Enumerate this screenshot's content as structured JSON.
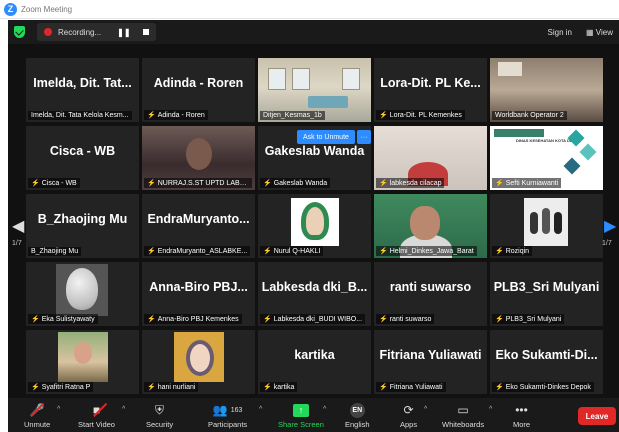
{
  "window": {
    "title": "Zoom Meeting",
    "logo_letter": "Z"
  },
  "topbar": {
    "recording": "Recording...",
    "pause": "❚❚",
    "sign_in": "Sign in",
    "view": "View"
  },
  "tiles": [
    {
      "big": "Imelda, Dit. Tat...",
      "name": "Imelda, Dit. Tata Kelola Kesm...",
      "muted": false
    },
    {
      "big": "Adinda - Roren",
      "name": "Adinda - Roren",
      "muted": true
    },
    {
      "big": "",
      "name": "Ditjen_Kesmas_1b",
      "muted": false
    },
    {
      "big": "Lora-Dit. PL Ke...",
      "name": "Lora-Dit. PL Kemenkes",
      "muted": true
    },
    {
      "big": "",
      "name": "Worldbank Operator 2",
      "muted": false
    },
    {
      "big": "Cisca - WB",
      "name": "Cisca - WB",
      "muted": true
    },
    {
      "big": "",
      "name": "NURRAJ.S.ST UPTD LABK...",
      "muted": true
    },
    {
      "big": "Gakeslab Wanda",
      "name": "Gakeslab Wanda",
      "muted": true
    },
    {
      "big": "",
      "name": "labkesda cilacap",
      "muted": true
    },
    {
      "big": "",
      "name": "Sefti Kurniawanti",
      "muted": true
    },
    {
      "big": "B_Zhaojing Mu",
      "name": "B_Zhaojing Mu",
      "muted": false
    },
    {
      "big": "EndraMuryanto...",
      "name": "EndraMuryanto_ASLABKE...",
      "muted": true
    },
    {
      "big": "",
      "name": "Nurul Q-HAKLI",
      "muted": true
    },
    {
      "big": "",
      "name": "Helmi_Dinkes_Jawa_Barat",
      "muted": true
    },
    {
      "big": "",
      "name": "Roziqin",
      "muted": true
    },
    {
      "big": "",
      "name": "Eka Sulistyawaty",
      "muted": true
    },
    {
      "big": "Anna-Biro PBJ...",
      "name": "Anna-Biro PBJ Kemenkes",
      "muted": true
    },
    {
      "big": "Labkesda dki_B...",
      "name": "Labkesda dki_BUDI WIBO...",
      "muted": true
    },
    {
      "big": "ranti suwarso",
      "name": "ranti suwarso",
      "muted": true
    },
    {
      "big": "PLB3_Sri Mulyani",
      "name": "PLB3_Sri Mulyani",
      "muted": true
    },
    {
      "big": "",
      "name": "Syafitri Ratna P",
      "muted": true
    },
    {
      "big": "",
      "name": "hani nurliani",
      "muted": true
    },
    {
      "big": "kartika",
      "name": "kartika",
      "muted": true
    },
    {
      "big": "Fitriana Yuliawati",
      "name": "Fitriana Yuliawati",
      "muted": true
    },
    {
      "big": "Eko Sukamti-Di...",
      "name": "Eko Sukamti-Dinkes Depok",
      "muted": true
    }
  ],
  "hover": {
    "ask_to_unmute": "Ask to Unmute",
    "more": "···"
  },
  "pager": {
    "left": "1/7",
    "right": "1/7"
  },
  "slide": {
    "title": "DINAS KESEHATAN KOTA DEPOK"
  },
  "toolbar": {
    "unmute": "Unmute",
    "start_video": "Start Video",
    "security": "Security",
    "participants": "Participants",
    "participants_count": "163",
    "share_screen": "Share Screen",
    "english": "English",
    "english_badge": "EN",
    "apps": "Apps",
    "whiteboards": "Whiteboards",
    "more": "More",
    "leave": "Leave"
  },
  "colors": {
    "accent": "#2d8cff",
    "share": "#23d959",
    "leave": "#e02828",
    "active_speaker": "#e7f25a"
  }
}
